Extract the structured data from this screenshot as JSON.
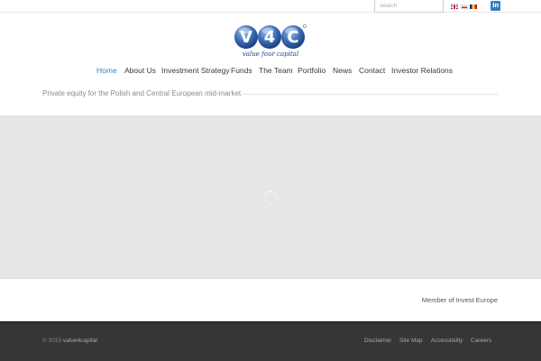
{
  "topbar": {
    "search_placeholder": "Search",
    "languages": [
      {
        "code": "en",
        "icon": "uk-flag-icon"
      },
      {
        "code": "pl",
        "icon": "poland-flag-icon"
      },
      {
        "code": "ro",
        "icon": "romania-flag-icon"
      }
    ],
    "linkedin_label": "in"
  },
  "logo": {
    "letters": [
      "V",
      "4",
      "C"
    ],
    "tagline": "value four capital",
    "brand_color": "#1d3f82"
  },
  "nav": {
    "items": [
      {
        "label": "Home",
        "active": true
      },
      {
        "label": "About Us"
      },
      {
        "label": "Investment Strategy"
      },
      {
        "label": "Funds"
      },
      {
        "label": "The Team"
      },
      {
        "label": "Portfolio"
      },
      {
        "label": "News"
      },
      {
        "label": "Contact"
      },
      {
        "label": "Investor Relations"
      }
    ],
    "active_color": "#2f86c9"
  },
  "hero": {
    "tagline": "Private equity for the Polish and Central European mid-market"
  },
  "member": {
    "text": "Member of Invest Europe"
  },
  "footer": {
    "copyright_prefix": "© 2015",
    "copyright_name": "value4capital",
    "links": [
      "Disclaimer",
      "Site Map",
      "Accessibility",
      "Careers"
    ]
  }
}
